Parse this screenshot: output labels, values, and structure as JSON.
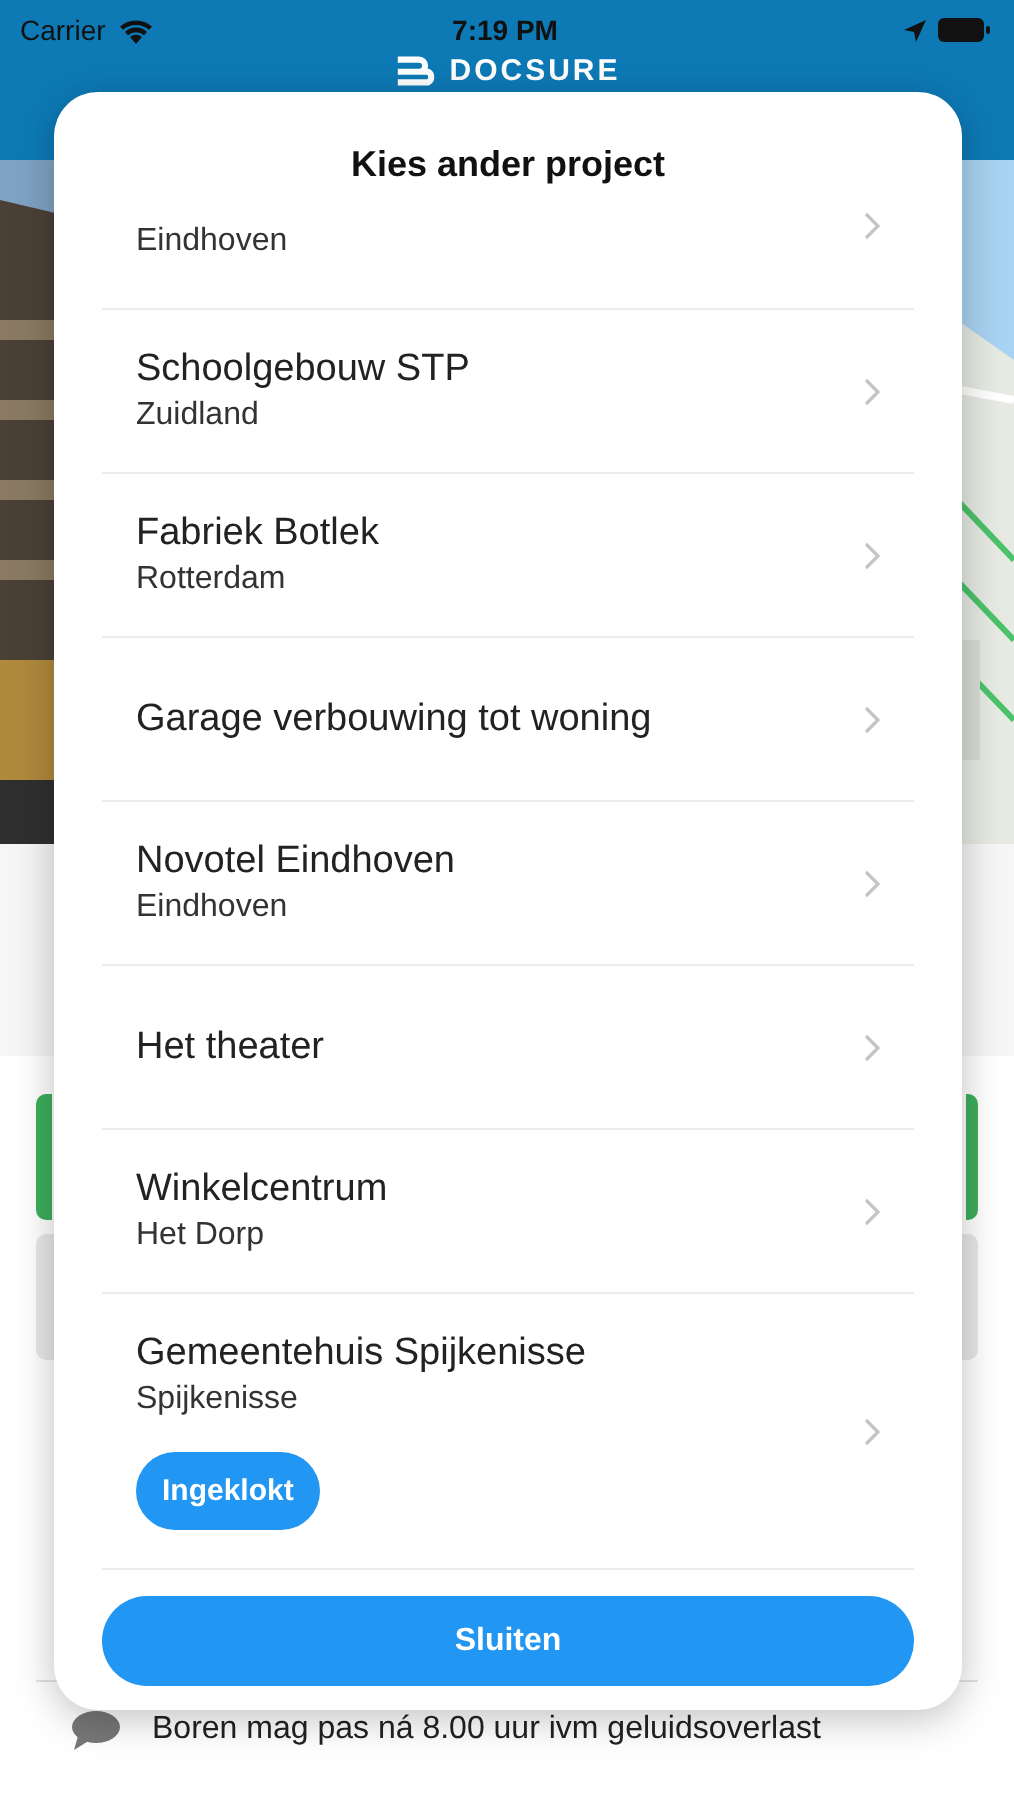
{
  "status_bar": {
    "carrier": "Carrier",
    "time": "7:19 PM"
  },
  "header": {
    "logo_text": "DOCSURE"
  },
  "modal": {
    "title": "Kies ander project",
    "items": [
      {
        "subtitle": "Eindhoven"
      },
      {
        "title": "Schoolgebouw STP",
        "subtitle": "Zuidland"
      },
      {
        "title": "Fabriek Botlek",
        "subtitle": "Rotterdam"
      },
      {
        "title": "Garage verbouwing tot woning"
      },
      {
        "title": "Novotel Eindhoven",
        "subtitle": "Eindhoven"
      },
      {
        "title": "Het theater"
      },
      {
        "title": "Winkelcentrum",
        "subtitle": "Het Dorp"
      },
      {
        "title": "Gemeentehuis Spijkenisse",
        "subtitle": "Spijkenisse",
        "badge": "Ingeklokt"
      }
    ],
    "close_button": "Sluiten"
  },
  "note": {
    "text": "Boren mag pas ná 8.00 uur ivm geluidsoverlast"
  }
}
